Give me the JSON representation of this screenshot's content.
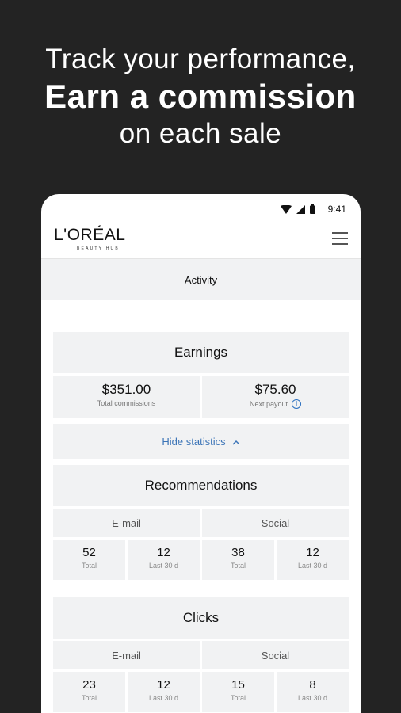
{
  "promo": {
    "line1": "Track your performance,",
    "line2": "Earn a commission",
    "line3": "on each sale"
  },
  "status": {
    "time": "9:41"
  },
  "header": {
    "brand": "L'ORÉAL",
    "brand_sub": "BEAUTY HUB"
  },
  "activity": {
    "label": "Activity"
  },
  "earnings": {
    "title": "Earnings",
    "total_value": "$351.00",
    "total_label": "Total commissions",
    "payout_value": "$75.60",
    "payout_label": "Next payout"
  },
  "toggle": {
    "label": "Hide statistics"
  },
  "recommendations": {
    "title": "Recommendations",
    "email_label": "E-mail",
    "social_label": "Social",
    "stats": [
      {
        "value": "52",
        "label": "Total"
      },
      {
        "value": "12",
        "label": "Last 30 d"
      },
      {
        "value": "38",
        "label": "Total"
      },
      {
        "value": "12",
        "label": "Last 30 d"
      }
    ]
  },
  "clicks": {
    "title": "Clicks",
    "email_label": "E-mail",
    "social_label": "Social",
    "stats": [
      {
        "value": "23",
        "label": "Total"
      },
      {
        "value": "12",
        "label": "Last 30 d"
      },
      {
        "value": "15",
        "label": "Total"
      },
      {
        "value": "8",
        "label": "Last 30 d"
      }
    ]
  },
  "colors": {
    "background": "#232323",
    "accent": "#3b74b7",
    "card": "#f1f2f3"
  }
}
